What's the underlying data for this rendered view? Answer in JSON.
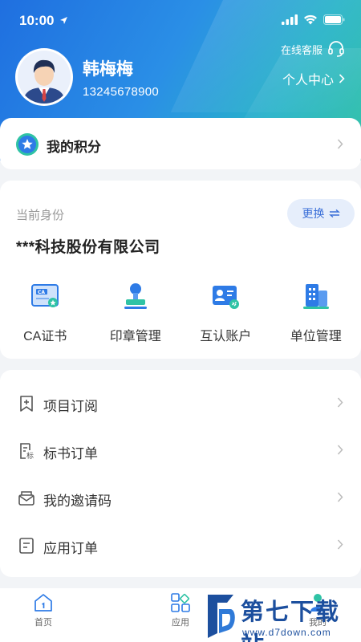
{
  "status_bar": {
    "time": "10:00",
    "icons": [
      "location-arrow-icon",
      "signal-icon",
      "wifi-icon",
      "battery-icon"
    ]
  },
  "profile": {
    "name": "韩梅梅",
    "phone": "13245678900",
    "service_label": "在线客服",
    "personal_center_label": "个人中心"
  },
  "points": {
    "label": "我的积分"
  },
  "identity": {
    "current_label": "当前身份",
    "switch_label": "更换",
    "company": "***科技股份有限公司",
    "actions": [
      {
        "label": "CA证书",
        "icon": "ca-certificate-icon"
      },
      {
        "label": "印章管理",
        "icon": "seal-icon"
      },
      {
        "label": "互认账户",
        "icon": "mutual-account-icon"
      },
      {
        "label": "单位管理",
        "icon": "organization-icon"
      }
    ]
  },
  "menu": [
    {
      "label": "项目订阅",
      "icon": "bookmark-plus-icon"
    },
    {
      "label": "标书订单",
      "icon": "tender-document-icon"
    },
    {
      "label": "我的邀请码",
      "icon": "envelope-icon"
    },
    {
      "label": "应用订单",
      "icon": "order-list-icon"
    }
  ],
  "tabbar": {
    "tabs": [
      {
        "label": "首页",
        "icon": "home-icon"
      },
      {
        "label": "应用",
        "icon": "apps-icon"
      },
      {
        "label": "我的",
        "icon": "user-icon"
      }
    ]
  },
  "watermark": {
    "title": "第七下载站",
    "url": "www.d7down.com"
  },
  "colors": {
    "header_start": "#1f6fe0",
    "header_end": "#31c2a6",
    "accent": "#3a6fd8",
    "icon_blue": "#2e7be6",
    "icon_teal": "#2fc3a5"
  }
}
